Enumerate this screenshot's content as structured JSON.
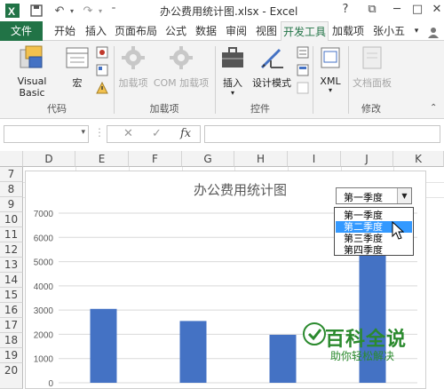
{
  "window": {
    "title": "办公费用统计图.xlsx - Excel",
    "help": "?",
    "minimize": "─",
    "restore": "□",
    "close": "✕",
    "ribbon_display": "⧉"
  },
  "tabs": [
    "文件",
    "开始",
    "插入",
    "页面布局",
    "公式",
    "数据",
    "审阅",
    "视图",
    "开发工具",
    "加载项",
    "张小五"
  ],
  "active_tab": "开发工具",
  "ribbon": {
    "groups": [
      {
        "label": "代码",
        "buttons": [
          "Visual Basic",
          "宏"
        ]
      },
      {
        "label": "加载项",
        "buttons": [
          "加载项",
          "COM 加载项"
        ]
      },
      {
        "label": "控件",
        "buttons": [
          "插入",
          "设计模式"
        ]
      },
      {
        "label": "",
        "buttons": [
          "XML"
        ]
      },
      {
        "label": "修改",
        "buttons": [
          "文档面板"
        ]
      }
    ]
  },
  "formula_bar": {
    "fx": "fx",
    "cancel": "✕",
    "enter": "✓"
  },
  "columns": [
    "D",
    "E",
    "F",
    "G",
    "H",
    "I",
    "J",
    "K"
  ],
  "rows": [
    "7",
    "8",
    "9",
    "10",
    "11",
    "12",
    "13",
    "14",
    "15",
    "16",
    "17",
    "18",
    "19",
    "20"
  ],
  "combo": {
    "value": "第一季度",
    "options": [
      "第一季度",
      "第二季度",
      "第三季度",
      "第四季度"
    ],
    "highlighted_index": 1
  },
  "chart_data": {
    "type": "bar",
    "title": "办公费用统计图",
    "ylim": [
      0,
      7000
    ],
    "yticks": [
      "0",
      "1000",
      "2000",
      "3000",
      "4000",
      "5000",
      "6000",
      "7000"
    ],
    "values": [
      3050,
      2550,
      1980,
      6700
    ],
    "bar_color": "#4472c4"
  },
  "watermark": {
    "big": "百科全说",
    "small": "助你轻松解决"
  }
}
